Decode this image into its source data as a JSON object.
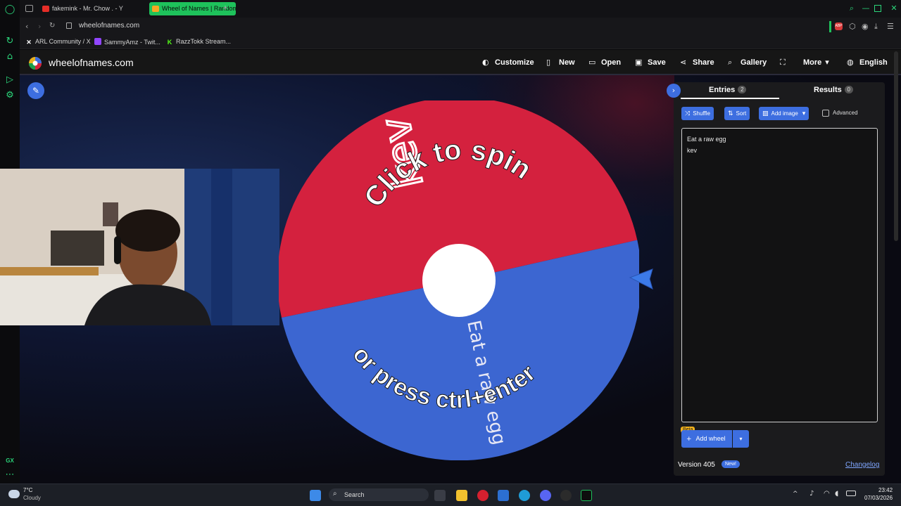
{
  "browser": {
    "tabs": [
      {
        "label": "fakemink - Mr. Chow . - Y"
      },
      {
        "label": "Wheel of Names | Random"
      }
    ],
    "new_tab_glyph": "+",
    "url": "wheelofnames.com",
    "bookmarks": [
      {
        "label": "ARL Community / X",
        "icon": "x-icon"
      },
      {
        "label": "SammyAmz - Twit...",
        "icon": "twitch-icon"
      },
      {
        "label": "RazzTokk Stream...",
        "icon": "kick-icon"
      }
    ],
    "accent_color": "#1ec25b"
  },
  "site": {
    "logo_text": "wheelofnames.com",
    "nav": {
      "customize": "Customize",
      "new": "New",
      "open": "Open",
      "save": "Save",
      "share": "Share",
      "gallery": "Gallery",
      "more": "More",
      "language": "English"
    }
  },
  "wheel": {
    "segments": [
      {
        "label": "kev",
        "color": "#d4213e"
      },
      {
        "label": "Eat a raw egg",
        "color": "#3c66d1"
      }
    ],
    "overlay_top": "Click to spin",
    "overlay_bottom": "or press ctrl+enter"
  },
  "panel": {
    "tabs": {
      "entries_label": "Entries",
      "entries_count": "2",
      "results_label": "Results",
      "results_count": "0"
    },
    "buttons": {
      "shuffle": "Shuffle",
      "sort": "Sort",
      "add_image": "Add image",
      "advanced": "Advanced"
    },
    "entries": [
      "Eat a raw egg",
      "kev"
    ],
    "beta_badge": "Beta",
    "add_wheel": "Add wheel",
    "version": "Version 405",
    "new_badge": "New!",
    "changelog": "Changelog"
  },
  "taskbar": {
    "weather_temp": "7°C",
    "weather_cond": "Cloudy",
    "search_placeholder": "Search",
    "time": "23:42",
    "date": "07/03/2026"
  },
  "gx_label": "GX"
}
